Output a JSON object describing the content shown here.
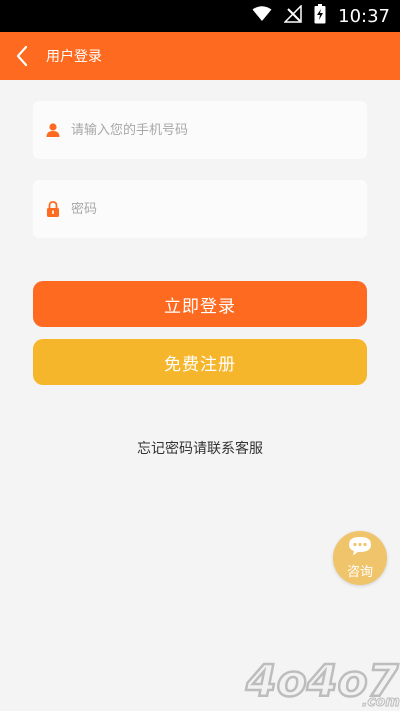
{
  "status_bar": {
    "time": "10:37"
  },
  "header": {
    "title": "用户登录",
    "back_icon": "chevron-left-icon"
  },
  "form": {
    "phone": {
      "placeholder": "请输入您的手机号码",
      "value": "",
      "icon": "user-icon"
    },
    "password": {
      "placeholder": "密码",
      "value": "",
      "icon": "lock-icon"
    },
    "login_label": "立即登录",
    "register_label": "免费注册",
    "forgot_text": "忘记密码请联系客服"
  },
  "consult": {
    "label": "咨询",
    "icon": "chat-bubble-icon"
  },
  "watermark": {
    "text": "4o4o7",
    "suffix": ".com"
  },
  "colors": {
    "accent": "#fe6a1f",
    "register": "#f6b62c",
    "consult": "#f0c46a",
    "background": "#f4f4f4"
  }
}
